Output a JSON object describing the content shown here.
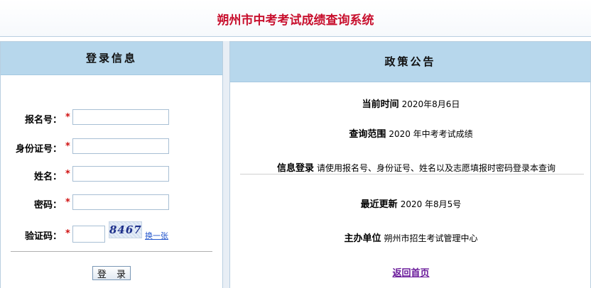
{
  "header": {
    "title": "朔州市中考考试成绩查询系统"
  },
  "login": {
    "heading": "登录信息",
    "fields": [
      {
        "label": "报名号：",
        "required_mark": "*",
        "value": ""
      },
      {
        "label": "身份证号：",
        "required_mark": "*",
        "value": ""
      },
      {
        "label": "姓名：",
        "required_mark": "*",
        "value": ""
      },
      {
        "label": "密码：",
        "required_mark": "*",
        "value": ""
      }
    ],
    "captcha": {
      "label": "验证码：",
      "required_mark": "*",
      "value": "",
      "image_text": "8467",
      "refresh_label": "换一张"
    },
    "submit_label": "登 录"
  },
  "notice": {
    "heading": "政策公告",
    "items": [
      {
        "key": "当前时间",
        "value": "2020年8月6日"
      },
      {
        "key": "查询范围",
        "value": "2020 年中考考试成绩"
      },
      {
        "key": "信息登录",
        "value": "请使用报名号、身份证号、姓名以及志愿填报时密码登录本查询"
      },
      {
        "key": "最近更新",
        "value": "2020 年8月5号"
      },
      {
        "key": "主办单位",
        "value": "朔州市招生考试管理中心"
      }
    ],
    "back_link": "返回首页"
  },
  "colors": {
    "title_red": "#c8102e",
    "panel_head_blue": "#b7d7ec",
    "link_purple": "#6a1b9a"
  }
}
